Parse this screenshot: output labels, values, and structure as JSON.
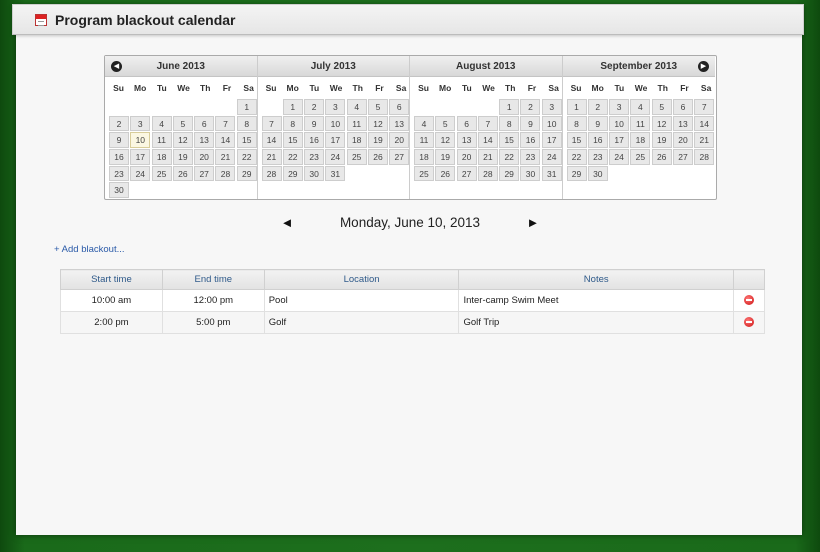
{
  "header": {
    "title": "Program blackout calendar",
    "icon": "calendar-icon"
  },
  "calendar": {
    "nav_prev_icon": "circle-left-arrow",
    "nav_next_icon": "circle-right-arrow",
    "weekdays": [
      "Su",
      "Mo",
      "Tu",
      "We",
      "Th",
      "Fr",
      "Sa"
    ],
    "months": [
      {
        "name": "June 2013",
        "first_weekday": 6,
        "days": 30,
        "today": 10
      },
      {
        "name": "July 2013",
        "first_weekday": 1,
        "days": 31
      },
      {
        "name": "August 2013",
        "first_weekday": 4,
        "days": 31
      },
      {
        "name": "September 2013",
        "first_weekday": 0,
        "days": 30
      }
    ]
  },
  "date_nav": {
    "prev": "◄",
    "next": "►",
    "current_date": "Monday, June 10, 2013"
  },
  "add_blackout": "+ Add blackout...",
  "table": {
    "headers": [
      "Start time",
      "End time",
      "Location",
      "Notes",
      ""
    ],
    "rows": [
      {
        "start": "10:00 am",
        "end": "12:00 pm",
        "location": "Pool",
        "notes": "Inter-camp Swim Meet"
      },
      {
        "start": "2:00 pm",
        "end": "5:00 pm",
        "location": "Golf",
        "notes": "Golf Trip"
      }
    ]
  },
  "colors": {
    "accent_link": "#2a5aa8",
    "background_green": "#1d6f1d",
    "remove_red": "#cc1111"
  }
}
